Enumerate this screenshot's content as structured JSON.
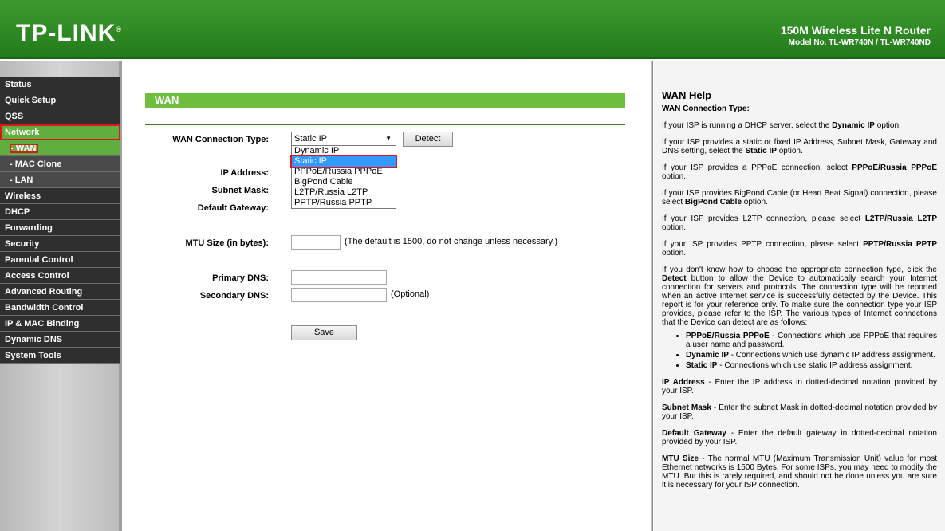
{
  "header": {
    "logo": "TP-LINK",
    "product_name": "150M Wireless Lite N Router",
    "model": "Model No. TL-WR740N / TL-WR740ND"
  },
  "menu": {
    "items": [
      {
        "label": "Status"
      },
      {
        "label": "Quick Setup"
      },
      {
        "label": "QSS"
      },
      {
        "label": "Network"
      },
      {
        "label": "- WAN"
      },
      {
        "label": "- MAC Clone"
      },
      {
        "label": "- LAN"
      },
      {
        "label": "Wireless"
      },
      {
        "label": "DHCP"
      },
      {
        "label": "Forwarding"
      },
      {
        "label": "Security"
      },
      {
        "label": "Parental Control"
      },
      {
        "label": "Access Control"
      },
      {
        "label": "Advanced Routing"
      },
      {
        "label": "Bandwidth Control"
      },
      {
        "label": "IP & MAC Binding"
      },
      {
        "label": "Dynamic DNS"
      },
      {
        "label": "System Tools"
      }
    ]
  },
  "main": {
    "title": "WAN",
    "wan_type_label": "WAN Connection Type:",
    "wan_type_value": "Static IP",
    "detect_label": "Detect",
    "options": [
      "Dynamic IP",
      "Static IP",
      "PPPoE/Russia PPPoE",
      "BigPond Cable",
      "L2TP/Russia L2TP",
      "PPTP/Russia PPTP"
    ],
    "ip_label": "IP Address:",
    "mask_label": "Subnet Mask:",
    "gateway_label": "Default Gateway:",
    "mtu_label": "MTU Size (in bytes):",
    "mtu_note": "(The default is 1500, do not change unless necessary.)",
    "dns1_label": "Primary DNS:",
    "dns2_label": "Secondary DNS:",
    "optional_note": "(Optional)",
    "save_label": "Save"
  },
  "help": {
    "title": "WAN Help",
    "subtitle": "WAN Connection Type:",
    "p1a": "If your ISP is running a DHCP server, select the ",
    "p1b": "Dynamic IP",
    "p1c": " option.",
    "p2a": "If your ISP provides a static or fixed IP Address, Subnet Mask, Gateway and DNS setting, select the ",
    "p2b": "Static IP",
    "p2c": " option.",
    "p3a": "If your ISP provides a PPPoE connection, select ",
    "p3b": "PPPoE/Russia PPPoE",
    "p3c": " option.",
    "p4a": "If your ISP provides BigPond Cable (or Heart Beat Signal) connection, please select ",
    "p4b": "BigPond Cable",
    "p4c": " option.",
    "p5a": "If your ISP provides L2TP connection, please select ",
    "p5b": "L2TP/Russia L2TP",
    "p5c": " option.",
    "p6a": "If your ISP provides PPTP connection, please select ",
    "p6b": "PPTP/Russia PPTP",
    "p6c": " option.",
    "p7a": "If you don't know how to choose the appropriate connection type, click the ",
    "p7b": "Detect",
    "p7c": " button to allow the Device to automatically search your Internet connection for servers and protocols. The connection type will be reported when an active Internet service is successfully detected by the Device. This report is for your reference only. To make sure the connection type your ISP provides, please refer to the ISP. The various types of Internet connections that the Device can detect are as follows:",
    "li1a": "PPPoE/Russia PPPoE",
    "li1b": " - Connections which use PPPoE that requires a user name and password.",
    "li2a": "Dynamic IP",
    "li2b": " - Connections which use dynamic IP address assignment.",
    "li3a": "Static IP",
    "li3b": " - Connections which use static IP address assignment.",
    "p8a": "IP Address",
    "p8b": " - Enter the IP address in dotted-decimal notation provided by your ISP.",
    "p9a": "Subnet Mask",
    "p9b": " - Enter the subnet Mask in dotted-decimal notation provided by your ISP.",
    "p10a": "Default Gateway",
    "p10b": " - Enter the default gateway in dotted-decimal notation provided by your ISP.",
    "p11a": "MTU Size",
    "p11b": " - The normal MTU (Maximum Transmission Unit) value for most Ethernet networks is 1500 Bytes. For some ISPs, you may need to modify the MTU. But this is rarely required, and should not be done unless you are sure it is necessary for your ISP connection."
  }
}
